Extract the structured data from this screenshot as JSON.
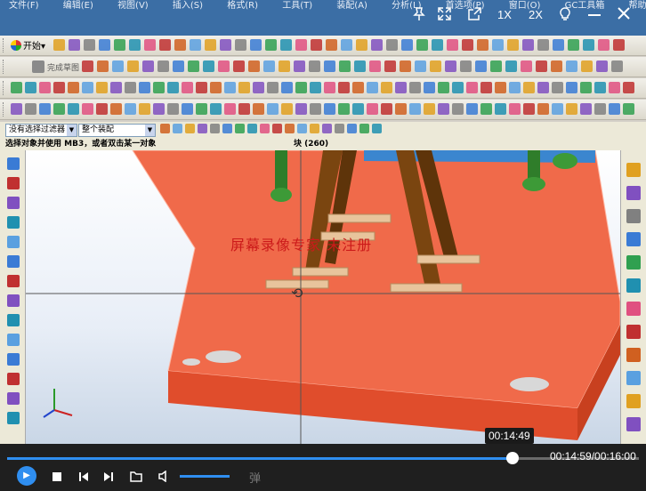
{
  "menu": {
    "items": [
      "文件(F)",
      "编辑(E)",
      "视图(V)",
      "插入(S)",
      "格式(R)",
      "工具(T)",
      "装配(A)",
      "分析(L)",
      "首选项(P)",
      "窗口(O)",
      "GC工具箱",
      "帮助(H)"
    ]
  },
  "toolbar": {
    "start_label": "开始▾",
    "finish_sketch": "完成草图"
  },
  "selection": {
    "filter": "没有选择过滤器",
    "scope": "整个装配"
  },
  "status": {
    "prompt": "选择对象并使用 MB3，或者双击某一对象",
    "block": "块 (260)"
  },
  "viewport": {
    "watermark": "屏幕录像专家  未注册",
    "cursor_icon": "rotate-cursor-icon"
  },
  "player": {
    "top_controls": {
      "speed_1x": "1X",
      "speed_2x": "2X"
    },
    "time_bubble": "00:14:49",
    "timecode": "00:14:59/00:16:00",
    "progress_fraction": 0.8,
    "volume_fraction": 1.0,
    "danmaku_label": "弹",
    "accent": "#2f8ef0"
  },
  "colors": {
    "plate": "#f06a4a",
    "pillar": "#7a4510",
    "pin": "#2f7d2a",
    "title_bar": "#3b6ea5"
  }
}
